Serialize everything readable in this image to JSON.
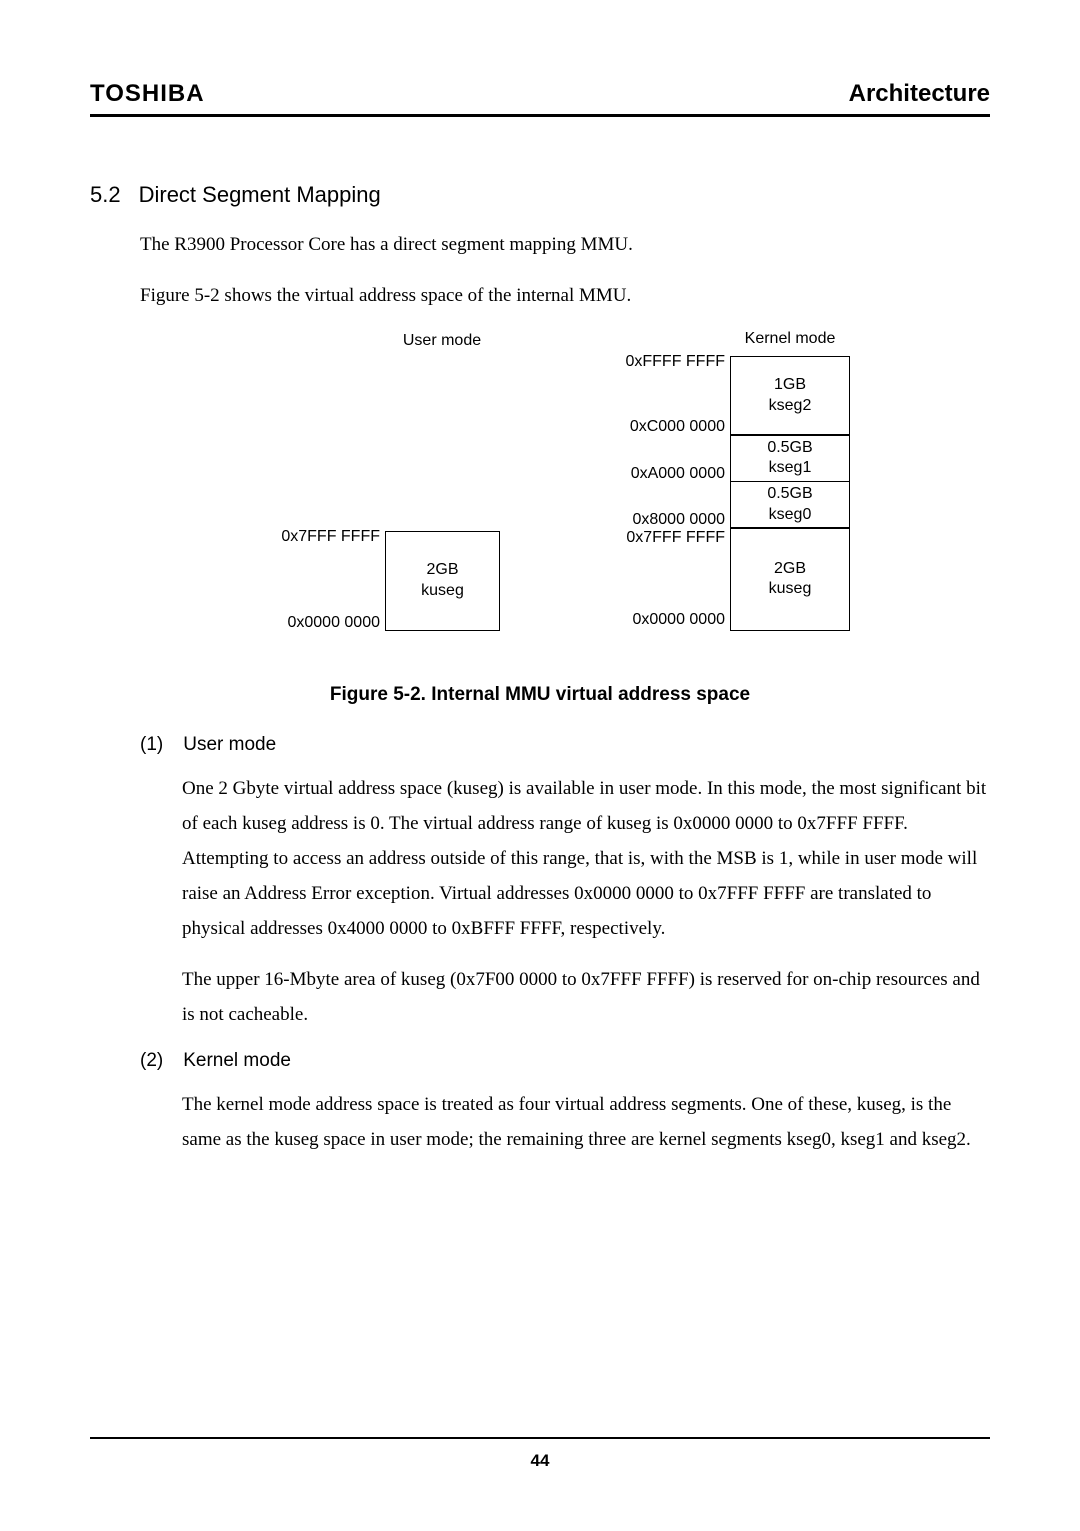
{
  "header": {
    "brand": "TOSHIBA",
    "chapter": "Architecture"
  },
  "section": {
    "number": "5.2",
    "title": "Direct Segment Mapping",
    "p1": "The R3900 Processor Core has a direct segment mapping MMU.",
    "p2": "Figure 5-2 shows the virtual address space of the internal MMU."
  },
  "figure": {
    "user_header": "User mode",
    "kernel_header": "Kernel mode",
    "user": {
      "addr_top": "0x7FFF FFFF",
      "addr_bottom": "0x0000 0000",
      "seg_size": "2GB",
      "seg_name": "kuseg"
    },
    "kernel": {
      "addr_ffff": "0xFFFF FFFF",
      "addr_c000": "0xC000 0000",
      "addr_a000": "0xA000 0000",
      "addr_8000": "0x8000 0000",
      "addr_7fff": "0x7FFF FFFF",
      "addr_0000": "0x0000 0000",
      "kseg2_size": "1GB",
      "kseg2_name": "kseg2",
      "kseg1_size": "0.5GB",
      "kseg1_name": "kseg1",
      "kseg0_size": "0.5GB",
      "kseg0_name": "kseg0",
      "kuseg_size": "2GB",
      "kuseg_name": "kuseg"
    },
    "caption": "Figure 5-2.   Internal MMU virtual address space"
  },
  "sub1": {
    "num": "(1)",
    "title": "User mode",
    "p1": "One 2 Gbyte virtual address space (kuseg) is available in user mode.   In this mode, the most significant bit of each kuseg address is 0.   The virtual address range of kuseg is 0x0000 0000 to 0x7FFF FFFF.   Attempting to access an address outside of this range, that is, with the MSB is 1, while in user mode will raise an Address Error exception.   Virtual addresses 0x0000 0000 to 0x7FFF FFFF are translated to physical addresses 0x4000 0000 to 0xBFFF FFFF, respectively.",
    "p2": "The upper 16-Mbyte area of kuseg (0x7F00 0000 to 0x7FFF FFFF) is reserved for on-chip resources and is not cacheable."
  },
  "sub2": {
    "num": "(2)",
    "title": "Kernel mode",
    "p1": "The kernel mode address space is treated as four virtual address segments.   One of these, kuseg, is the same as the kuseg space in user mode; the remaining three are kernel segments kseg0, kseg1 and kseg2."
  },
  "page_number": "44"
}
